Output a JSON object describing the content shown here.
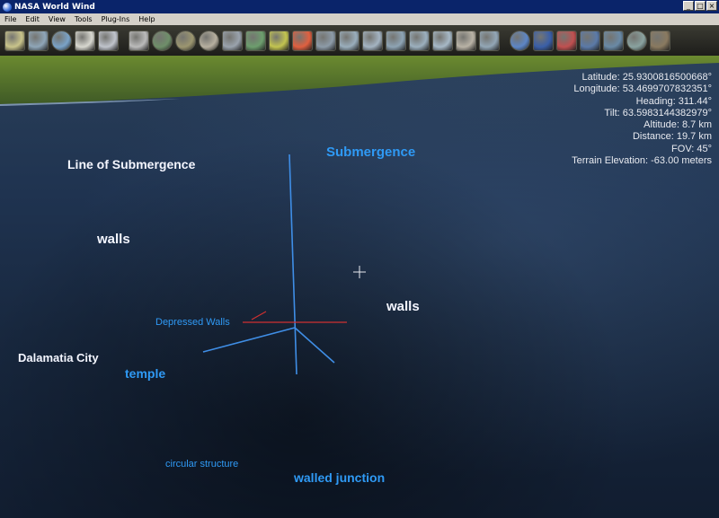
{
  "window": {
    "title": "NASA World Wind",
    "controls": [
      "_",
      "□",
      "×"
    ]
  },
  "menu": [
    "File",
    "Edit",
    "View",
    "Tools",
    "Plug-Ins",
    "Help"
  ],
  "toolbar": {
    "buttons": [
      {
        "name": "layer-manager-icon",
        "color": "#c9c48b"
      },
      {
        "name": "grid-icon",
        "color": "#8fa6b8"
      },
      {
        "name": "globe-icon",
        "color": "#7aa3c8"
      },
      {
        "name": "clock-icon",
        "color": "#d8d8d0"
      },
      {
        "name": "frame-icon",
        "color": "#c0c4cc"
      },
      {
        "name": "magnifier-icon",
        "color": "#bbbbbb"
      },
      {
        "name": "globe-icon",
        "color": "#6f8f6a"
      },
      {
        "name": "globe-icon",
        "color": "#9c9670"
      },
      {
        "name": "globe-icon",
        "color": "#b7b0a0"
      },
      {
        "name": "satellite-icon",
        "color": "#9aa3ad"
      },
      {
        "name": "map-tile-icon",
        "color": "#6d9e6e"
      },
      {
        "name": "map-tile-icon",
        "color": "#c3c450"
      },
      {
        "name": "weather-icon",
        "color": "#e06040"
      },
      {
        "name": "map-tile-icon",
        "color": "#8d9ba8"
      },
      {
        "name": "map-tile-icon",
        "color": "#9aaebc"
      },
      {
        "name": "map-tile-icon",
        "color": "#a4b4c2"
      },
      {
        "name": "map-tile-icon",
        "color": "#8ea4b4"
      },
      {
        "name": "map-tile-icon",
        "color": "#9cb0be"
      },
      {
        "name": "map-tile-icon",
        "color": "#a7b9c7"
      },
      {
        "name": "map-tile-icon",
        "color": "#b9b3a6"
      },
      {
        "name": "map-tile-icon",
        "color": "#93a7b6"
      },
      {
        "name": "globe-icon",
        "color": "#5d86c6"
      },
      {
        "name": "map-tile-icon",
        "color": "#3a5fa8"
      },
      {
        "name": "flag-icon",
        "color": "#c05050"
      },
      {
        "name": "map-tile-icon",
        "color": "#5b7aa8"
      },
      {
        "name": "landsat-icon",
        "color": "#6a8aa6"
      },
      {
        "name": "globe-icon",
        "color": "#8aa3a0"
      },
      {
        "name": "panorama-icon",
        "color": "#8a7a60"
      }
    ]
  },
  "terrain_labels": [
    {
      "text": "Line of Submergence",
      "style": "white"
    },
    {
      "text": "Submergence",
      "style": "blue"
    },
    {
      "text": "walls",
      "style": "white"
    },
    {
      "text": "walls",
      "style": "white"
    },
    {
      "text": "Depressed Walls",
      "style": "blue-sm"
    },
    {
      "text": "Dalamatia City",
      "style": "white"
    },
    {
      "text": "temple",
      "style": "blue"
    },
    {
      "text": "circular structure",
      "style": "blue-sm"
    },
    {
      "text": "walled junction",
      "style": "blue"
    }
  ],
  "info": {
    "latitude": "Latitude: 25.9300816500668°",
    "longitude": "Longitude: 53.4699707832351°",
    "heading": "Heading: 311.44°",
    "tilt": "Tilt: 63.5983144382979°",
    "altitude": "Altitude: 8.7 km",
    "distance": "Distance: 19.7 km",
    "fov": "FOV: 45°",
    "terrain_elevation": "Terrain Elevation: -63.00 meters"
  },
  "colors": {
    "horizon_land": "#5b7a2a",
    "ocean": "#1f3350",
    "label_blue": "#2f9af5",
    "label_white": "#f4f6ff",
    "axis_blue": "#3f8ee6",
    "axis_red": "#d03030"
  }
}
